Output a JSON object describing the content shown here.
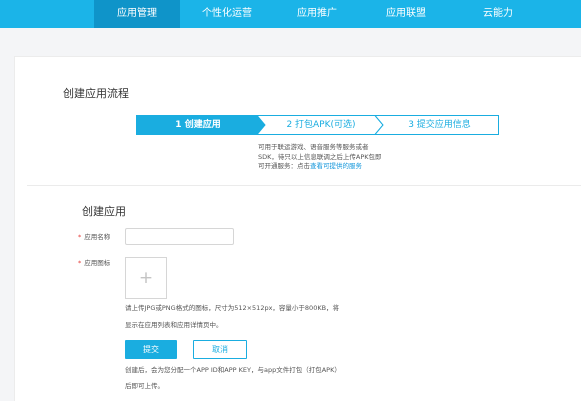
{
  "nav": {
    "items": [
      {
        "label": "应用管理",
        "active": true
      },
      {
        "label": "个性化运营",
        "active": false
      },
      {
        "label": "应用推广",
        "active": false
      },
      {
        "label": "应用联盟",
        "active": false
      },
      {
        "label": "云能力",
        "active": false
      }
    ]
  },
  "flow": {
    "title": "创建应用流程",
    "steps": [
      {
        "label": "1 创建应用",
        "active": true
      },
      {
        "label": "2 打包APK(可选)",
        "active": false
      },
      {
        "label": "3 提交应用信息",
        "active": false
      }
    ],
    "desc_lines": [
      "可用于联运游戏、语音服务等服务或者",
      "SDK，待只以上信息联调之后上传APK包即"
    ],
    "desc_prefix": "可开通服务：点击",
    "desc_link": "查看可提供的服务"
  },
  "form": {
    "title": "创建应用",
    "name_label": "应用名称",
    "name_value": "",
    "icon_label": "应用图标",
    "upload_symbol": "+",
    "icon_hint_1": "请上传JPG或PNG格式的图标，尺寸为512×512px，容量小于800KB，将",
    "icon_hint_2": "显示在应用列表和应用详情页中。",
    "submit_label": "提交",
    "cancel_label": "取消",
    "footer_hint_1": "创建后，会为您分配一个APP ID和APP KEY，与app文件打包（打包APK）",
    "footer_hint_2": "后即可上传。"
  },
  "colors": {
    "nav_bg": "#1bb4e8",
    "nav_active": "#0f94c9",
    "accent": "#1aade0",
    "required": "#e53935"
  }
}
